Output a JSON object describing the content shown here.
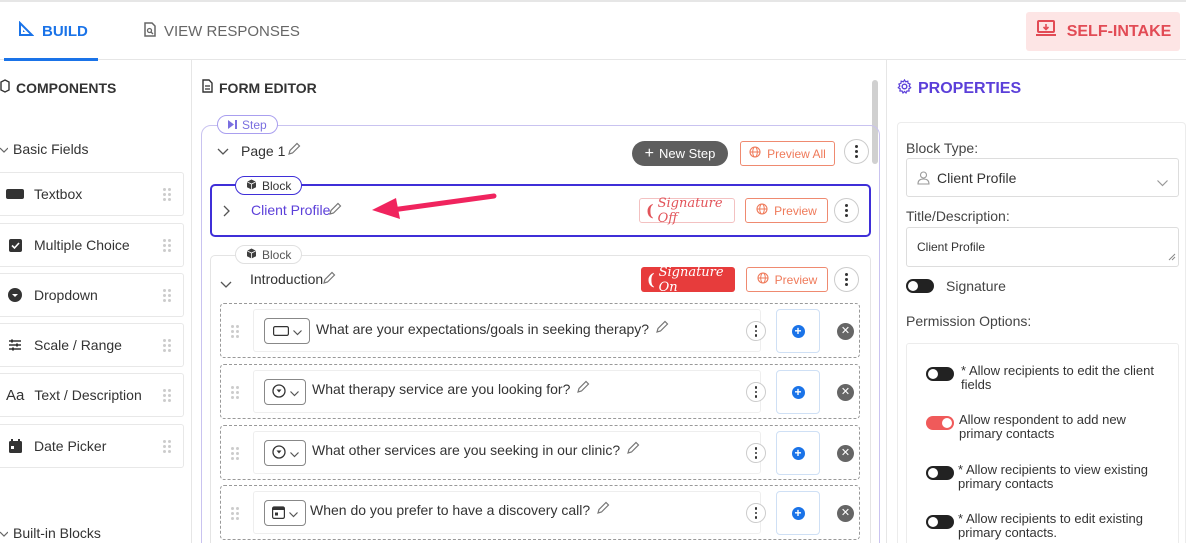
{
  "tabs": {
    "build": "BUILD",
    "view_responses": "VIEW RESPONSES",
    "self_intake": "SELF-INTAKE"
  },
  "components": {
    "title": "COMPONENTS",
    "basic_fields_label": "Basic Fields",
    "items": [
      {
        "label": "Textbox",
        "icon": "textbox-icon"
      },
      {
        "label": "Multiple Choice",
        "icon": "checkbox-icon"
      },
      {
        "label": "Dropdown",
        "icon": "dropdown-icon"
      },
      {
        "label": "Scale / Range",
        "icon": "sliders-icon"
      },
      {
        "label": "Text / Description",
        "icon": "text-icon"
      },
      {
        "label": "Date Picker",
        "icon": "calendar-icon"
      }
    ],
    "text_icon_glyph": "Aa",
    "built_in_label": "Built-in Blocks"
  },
  "editor": {
    "title": "FORM EDITOR",
    "step_label": "Step",
    "page_title": "Page 1",
    "new_step": "New Step",
    "preview_all": "Preview All",
    "blocks": [
      {
        "badge": "Block",
        "title": "Client Profile",
        "signature": "Signature Off",
        "preview": "Preview"
      },
      {
        "badge": "Block",
        "title": "Introduction",
        "signature": "Signature On",
        "preview": "Preview",
        "questions": [
          {
            "text": "What are your expectations/goals in seeking therapy?",
            "type_icon": "textbox-icon"
          },
          {
            "text": "What therapy service are you looking for?",
            "type_icon": "dropdown-icon"
          },
          {
            "text": "What other services are you seeking in our clinic?",
            "type_icon": "dropdown-icon"
          },
          {
            "text": "When do you prefer to have a discovery call?",
            "type_icon": "calendar-icon"
          }
        ]
      }
    ]
  },
  "properties": {
    "title": "PROPERTIES",
    "block_type_label": "Block Type:",
    "block_type_value": "Client Profile",
    "title_desc_label": "Title/Description:",
    "title_desc_value": "Client Profile",
    "signature_label": "Signature",
    "signature_on": false,
    "permission_label": "Permission Options:",
    "permissions": [
      {
        "text": "* Allow recipients to edit the client fields",
        "on": false
      },
      {
        "text": "Allow respondent to add new primary contacts",
        "on": true
      },
      {
        "text": "* Allow recipients to view existing primary contacts",
        "on": false
      },
      {
        "text": "* Allow recipients to edit existing primary contacts.",
        "on": false
      }
    ]
  },
  "colors": {
    "accent_blue": "#1a73e8",
    "block_purple": "#3f2fd8",
    "danger_red": "#e73c3c",
    "arrow_pink": "#f0245e"
  }
}
